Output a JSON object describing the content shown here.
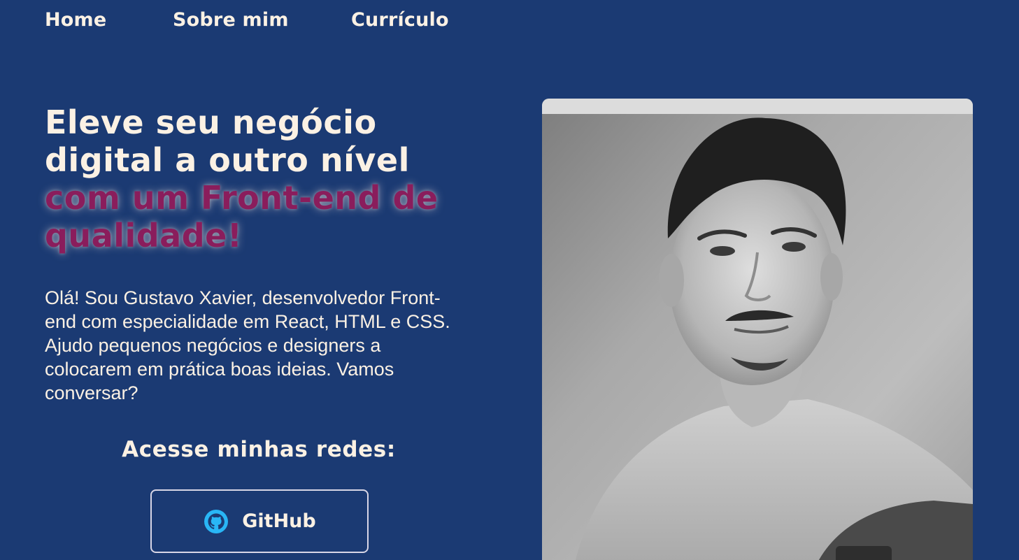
{
  "nav": {
    "items": [
      {
        "label": "Home"
      },
      {
        "label": "Sobre mim"
      },
      {
        "label": "Currículo"
      }
    ]
  },
  "hero": {
    "headline_line1": "Eleve seu negócio",
    "headline_line2": "digital a outro nível",
    "headline_accent1": "com um Front-end de",
    "headline_accent2": "qualidade!",
    "intro": "Olá! Sou Gustavo Xavier, desenvolvedor Front-end com especialidade em React, HTML e CSS. Ajudo pequenos negócios e designers a colocarem em prática boas ideias. Vamos conversar?"
  },
  "networks": {
    "title": "Acesse minhas redes:",
    "github_label": "GitHub",
    "github_icon": "github-icon"
  },
  "colors": {
    "background": "#1b3a73",
    "text": "#fbf1e4",
    "accent": "#8a1d5c",
    "github_icon": "#29b6f6"
  }
}
